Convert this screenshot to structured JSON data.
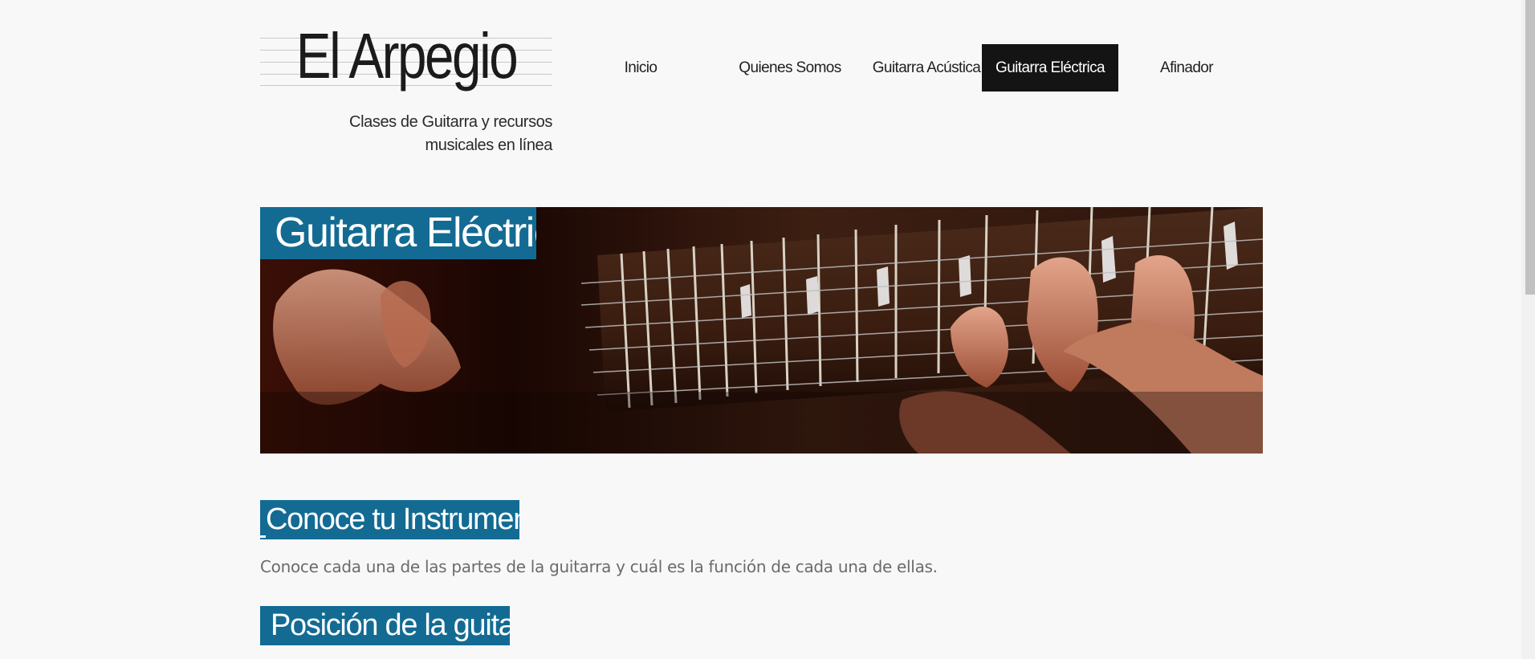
{
  "site": {
    "title": "El Arpegio",
    "tagline_line1": "Clases de Guitarra y recursos",
    "tagline_line2": "musicales en línea"
  },
  "nav": {
    "items": [
      {
        "label": "Inicio",
        "active": false
      },
      {
        "label": "Quienes Somos",
        "active": false
      },
      {
        "label": "Guitarra Acústica",
        "active": false
      },
      {
        "label": "Guitarra Eléctrica",
        "active": true
      },
      {
        "label": "Afinador",
        "active": false
      }
    ]
  },
  "banner": {
    "title": "Guitarra Eléctrica"
  },
  "sections": [
    {
      "heading": "Conoce tu Instrumento",
      "text": "Conoce cada una de las partes de la guitarra y cuál es la función de cada una de ellas."
    },
    {
      "heading": "Posición de la guitarra"
    }
  ],
  "colors": {
    "accent": "#136b93",
    "nav_active_bg": "#141414",
    "background": "#f8f8f9"
  }
}
